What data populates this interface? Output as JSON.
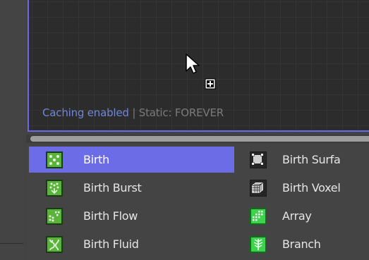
{
  "viewport": {
    "status_caching": "Caching enabled",
    "status_separator": " | ",
    "status_static": "Static: FOREVER"
  },
  "operators": {
    "left_column": [
      {
        "label": "Birth",
        "icon": "birth-icon",
        "selected": true
      },
      {
        "label": "Birth Burst",
        "icon": "birth-burst-icon",
        "selected": false
      },
      {
        "label": "Birth Flow",
        "icon": "birth-flow-icon",
        "selected": false
      },
      {
        "label": "Birth Fluid",
        "icon": "birth-fluid-icon",
        "selected": false
      }
    ],
    "right_column": [
      {
        "label": "Birth Surfa",
        "icon": "birth-surface-icon"
      },
      {
        "label": "Birth Voxel",
        "icon": "birth-voxel-icon"
      },
      {
        "label": "Array",
        "icon": "array-icon"
      },
      {
        "label": "Branch",
        "icon": "branch-icon"
      }
    ]
  },
  "colors": {
    "accent": "#6c6ce6",
    "caching_text": "#6f86d8",
    "icon_green": "#5ab33a",
    "icon_bright_green": "#3dd34b"
  }
}
